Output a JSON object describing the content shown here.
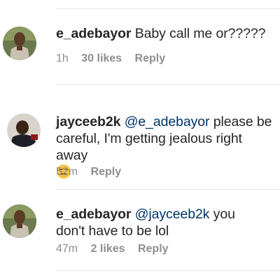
{
  "comments": [
    {
      "username": "e_adebayor",
      "mention": "",
      "text": "Baby call me or?????",
      "time": "1h",
      "likes": "30 likes",
      "reply": "Reply"
    },
    {
      "username": "jayceeb2k",
      "mention": "@e_adebayor",
      "text": "please be careful, I'm getting jealous right away",
      "emoji": "unamused-face-emoji",
      "time": "52m",
      "likes": "",
      "reply": "Reply"
    },
    {
      "username": "e_adebayor",
      "mention": "@jayceeb2k",
      "text": "you don't have to be lol",
      "time": "47m",
      "likes": "2 likes",
      "reply": "Reply"
    }
  ],
  "colors": {
    "username": "#262626",
    "mention": "#003569",
    "meta": "#8e8e8e",
    "divider": "#e6e6e6"
  }
}
